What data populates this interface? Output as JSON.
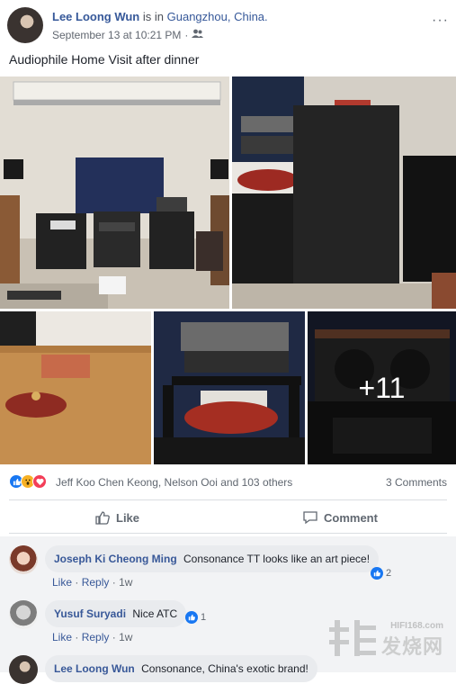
{
  "post": {
    "author": "Lee Loong Wun",
    "is_in_text": "is in",
    "location": "Guangzhou, China.",
    "timestamp": "September 13 at 10:21 PM",
    "separator": "·",
    "audience_icon": "friends-icon",
    "more_icon": "···",
    "text": "Audiophile Home Visit after dinner",
    "photos": {
      "more_count": "+11"
    }
  },
  "reactions": {
    "icons": [
      "like-icon",
      "wow-icon",
      "love-icon"
    ],
    "names": "Jeff Koo Chen Keong, Nelson Ooi and 103 others",
    "comments_count": "3 Comments"
  },
  "actions": {
    "like_label": "Like",
    "comment_label": "Comment"
  },
  "comments": [
    {
      "name": "Joseph Ki Cheong Ming",
      "text": "Consonance TT looks like an art piece!",
      "like": "Like",
      "reply": "Reply",
      "time": "1w",
      "reaction_count": "2",
      "dot": "·"
    },
    {
      "name": "Yusuf Suryadi",
      "text": "Nice ATC",
      "like": "Like",
      "reply": "Reply",
      "time": "1w",
      "reaction_count": "1",
      "dot": "·"
    },
    {
      "name": "Lee Loong Wun",
      "text": "Consonance, China's exotic brand!"
    }
  ],
  "watermark": {
    "url": "HIFI168.com",
    "chinese": "发烧网"
  },
  "colors": {
    "link": "#365899",
    "like_blue": "#1877f2",
    "love_red": "#f33e58",
    "wow_yellow": "#f7b125"
  }
}
